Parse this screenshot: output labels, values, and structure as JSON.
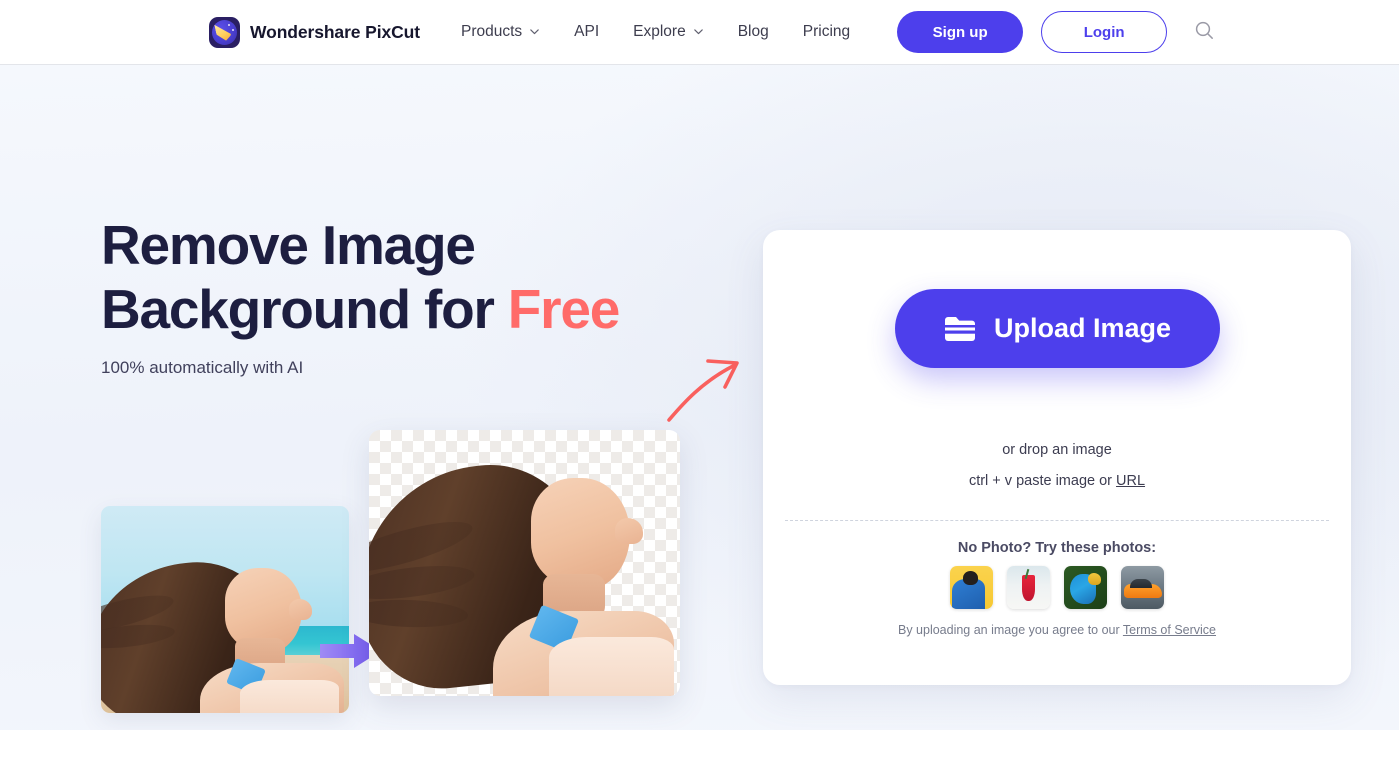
{
  "nav": {
    "brand": {
      "name": "Wondershare PixCut",
      "logo_icon": "pixcut-logo-icon"
    },
    "links": [
      {
        "label": "Products",
        "has_dropdown": true,
        "icon": "chevron-down-icon"
      },
      {
        "label": "API",
        "has_dropdown": false
      },
      {
        "label": "Explore",
        "has_dropdown": true,
        "icon": "chevron-down-icon"
      },
      {
        "label": "Blog",
        "has_dropdown": false
      },
      {
        "label": "Pricing",
        "has_dropdown": false
      }
    ],
    "signup_label": "Sign up",
    "login_label": "Login",
    "search_icon": "search-icon"
  },
  "hero": {
    "headline_line1": "Remove Image",
    "headline_line2_prefix": "Background for ",
    "headline_highlight": "Free",
    "subheadline": "100% automatically with AI",
    "before_image_alt": "woman-on-beach-original",
    "after_image_alt": "woman-on-beach-background-removed",
    "transition_arrow_icon": "right-arrow-icon",
    "pointer_arrow_icon": "curved-arrow-icon"
  },
  "upload_card": {
    "upload_button_label": "Upload Image",
    "upload_button_icon": "folder-icon",
    "drop_text": "or drop an image",
    "paste_text_prefix": "ctrl + v paste image or ",
    "paste_url_link": "URL",
    "try_photos_title": "No Photo? Try these photos:",
    "sample_photos": [
      {
        "name": "sample-person-yellow",
        "alt": "person in blue shirt on yellow background"
      },
      {
        "name": "sample-red-drink",
        "alt": "red cocktail drink in tall glass"
      },
      {
        "name": "sample-macaw-parrot",
        "alt": "blue and yellow macaw parrot"
      },
      {
        "name": "sample-orange-car",
        "alt": "orange sports car"
      }
    ],
    "terms_prefix": "By uploading an image you agree to our ",
    "terms_link": "Terms of Service"
  },
  "colors": {
    "primary": "#4d3fec",
    "accent_coral": "#ff6b69",
    "headline_navy": "#1d1e40",
    "page_background": "#f1f5fb",
    "card_background": "#ffffff"
  }
}
